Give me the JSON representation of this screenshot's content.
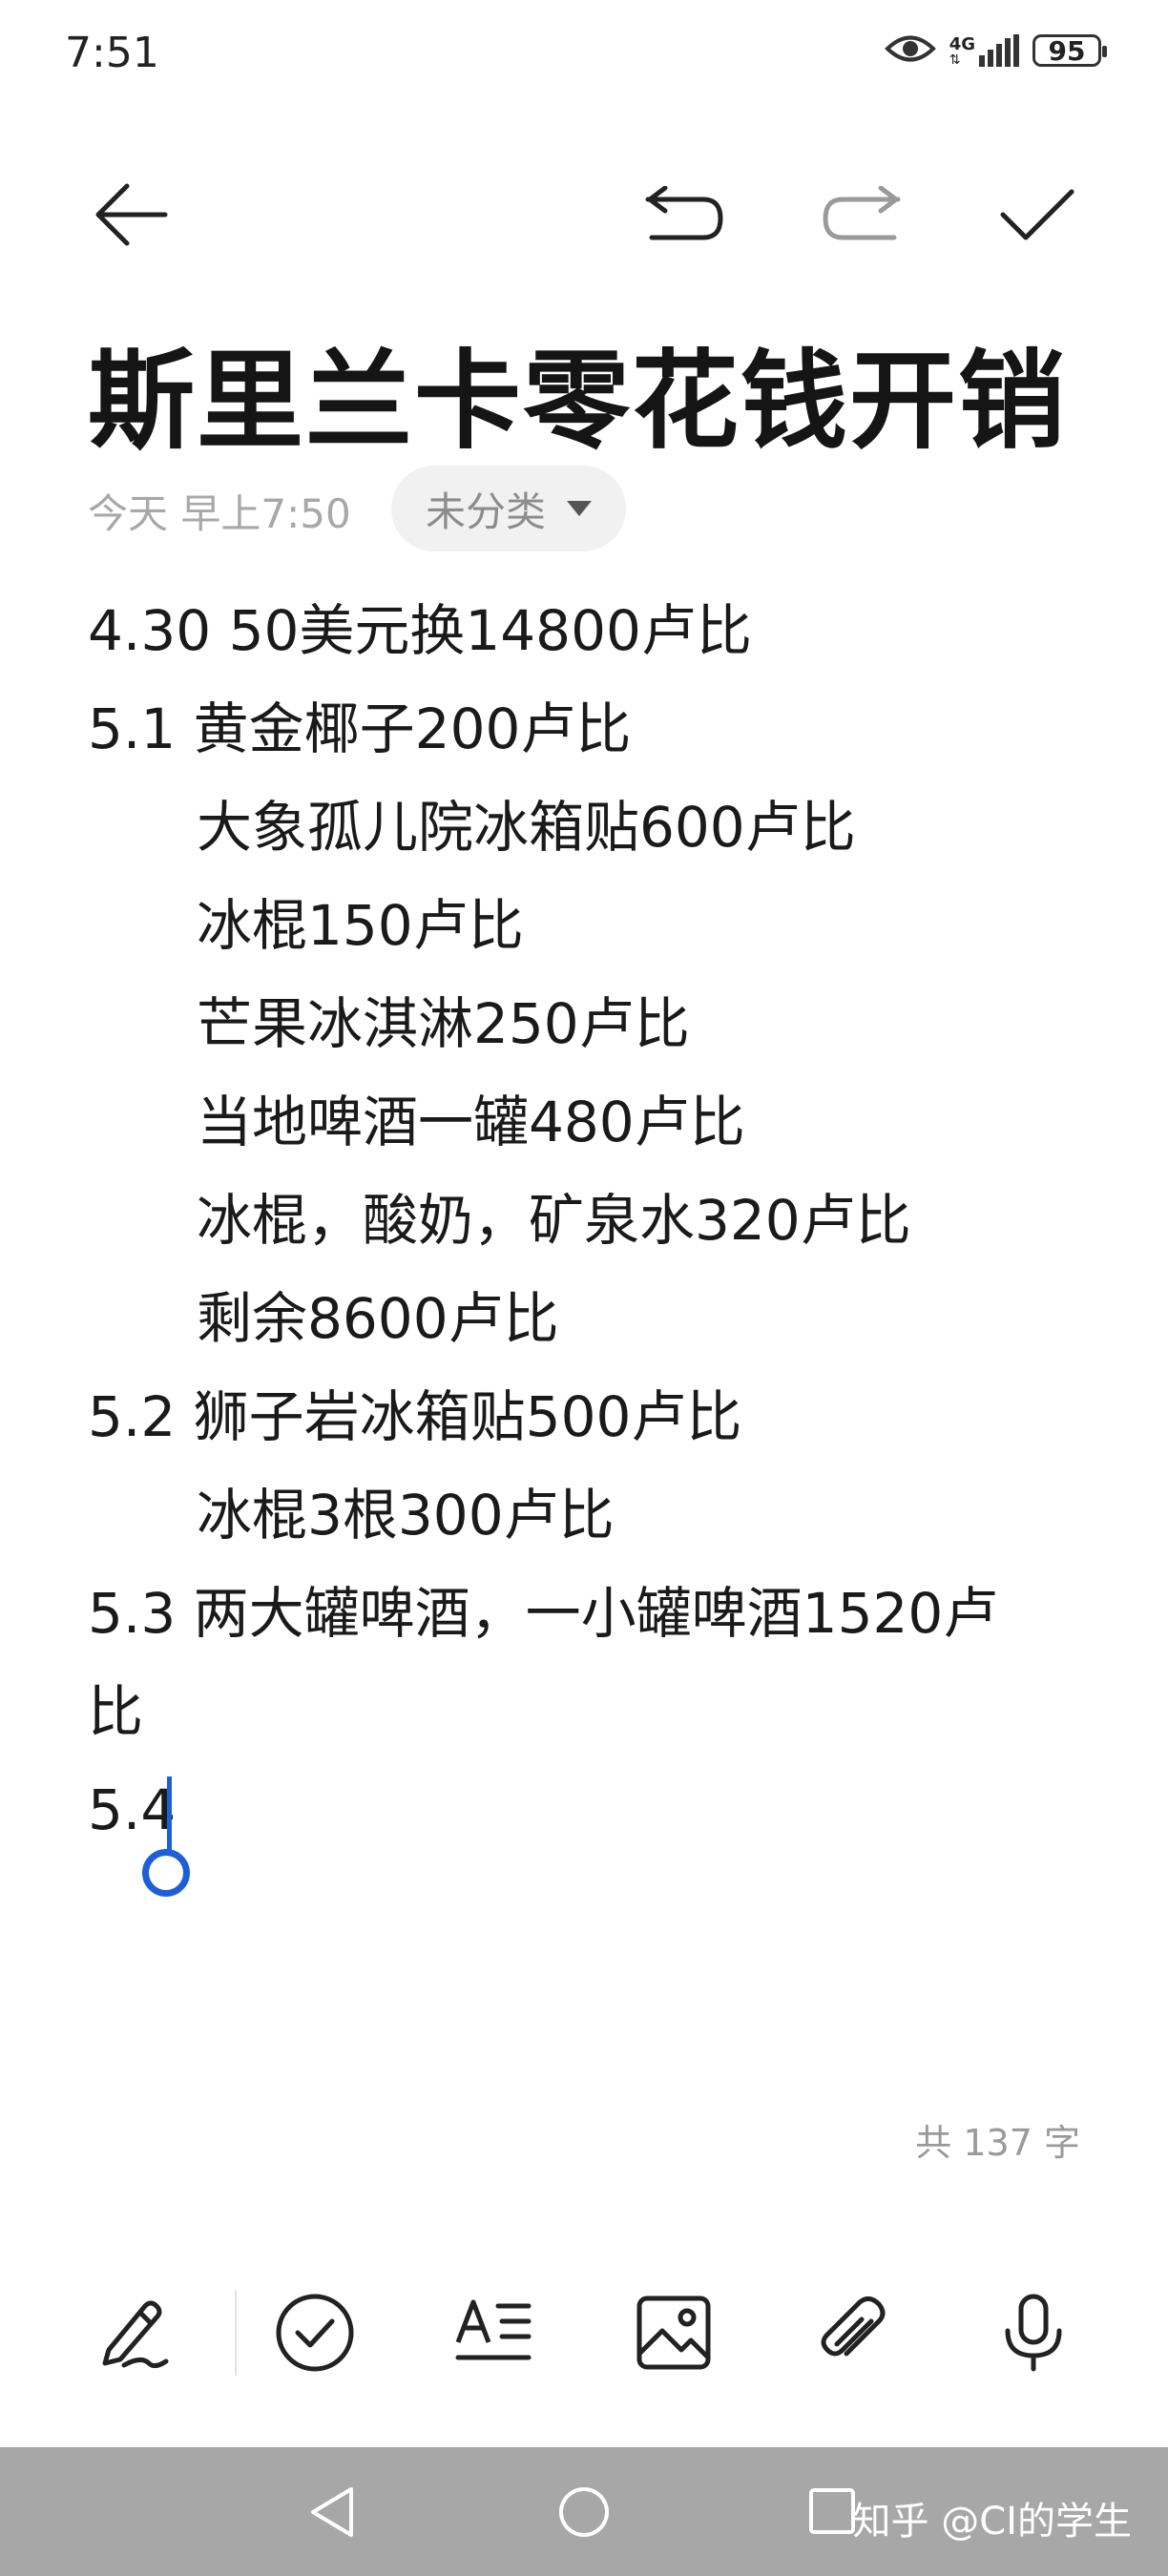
{
  "status_bar": {
    "time": "7:51",
    "network": "4G",
    "battery": "95",
    "icons": [
      "eye-icon",
      "signal-icon",
      "battery-icon"
    ]
  },
  "toolbar": {
    "icons": [
      "back-arrow-icon",
      "undo-icon",
      "redo-icon",
      "check-icon"
    ]
  },
  "note": {
    "title": "斯里兰卡零花钱开销",
    "date": "今天 早上7:50",
    "category": "未分类",
    "lines": [
      "4.30  50美元换14800卢比",
      "5.1  黄金椰子200卢比",
      "大象孤儿院冰箱贴600卢比",
      "冰棍150卢比",
      "芒果冰淇淋250卢比",
      "当地啤酒一罐480卢比",
      "冰棍，酸奶，矿泉水320卢比",
      "剩余8600卢比",
      "5.2  狮子岩冰箱贴500卢比",
      "冰棍3根300卢比",
      "5.3  两大罐啤酒，一小罐啤酒1520卢",
      "比",
      "5.4"
    ],
    "word_count": "共 137 字"
  },
  "bottom_toolbar": {
    "icons": [
      "handwriting-icon",
      "checklist-icon",
      "text-format-icon",
      "image-icon",
      "attachment-icon",
      "microphone-icon"
    ]
  },
  "nav_bar": {
    "icons": [
      "nav-back-icon",
      "nav-home-icon",
      "nav-recents-icon"
    ],
    "watermark": "知乎 @CI的学生"
  },
  "colors": {
    "cursor": "#1e5fd8",
    "meta_text": "#a8a8a8",
    "nav_bar": "#a7a7a7"
  }
}
